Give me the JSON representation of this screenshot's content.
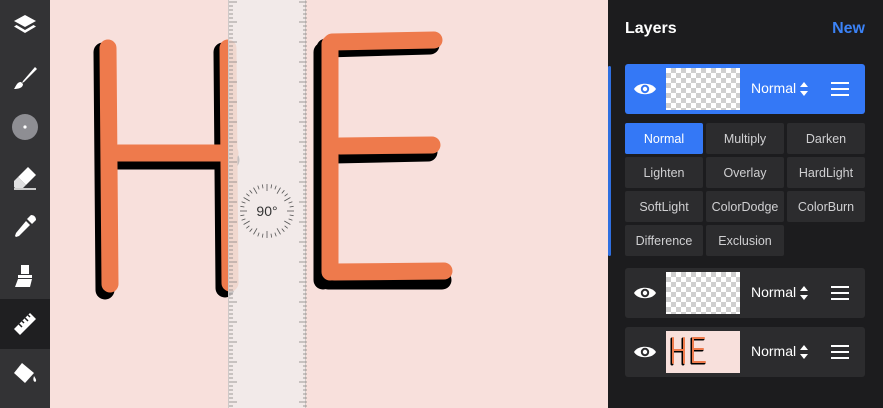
{
  "toolbar": {
    "tools": [
      {
        "name": "layers-icon"
      },
      {
        "name": "brush-icon"
      },
      {
        "name": "brush-size-icon"
      },
      {
        "name": "eraser-icon"
      },
      {
        "name": "eyedropper-icon"
      },
      {
        "name": "smudge-icon"
      },
      {
        "name": "ruler-icon",
        "active": true
      },
      {
        "name": "fill-icon"
      }
    ]
  },
  "canvas": {
    "text": "HE",
    "letter_color": "#ee7a4c",
    "shadow_color": "#000000",
    "background": "#f8e0dc",
    "ruler_angle": "90°"
  },
  "panel": {
    "title": "Layers",
    "new_label": "New",
    "accent": "#3478f6",
    "layers": [
      {
        "mode": "Normal",
        "visible": true,
        "selected": true,
        "thumb": "transparent"
      },
      {
        "mode": "Normal",
        "visible": true,
        "selected": false,
        "thumb": "transparent"
      },
      {
        "mode": "Normal",
        "visible": true,
        "selected": false,
        "thumb": "drawing"
      }
    ],
    "thumb_text": "HE",
    "blend_modes": [
      "Normal",
      "Multiply",
      "Darken",
      "Lighten",
      "Overlay",
      "HardLight",
      "SoftLight",
      "ColorDodge",
      "ColorBurn",
      "Difference",
      "Exclusion"
    ],
    "selected_blend": "Normal"
  }
}
